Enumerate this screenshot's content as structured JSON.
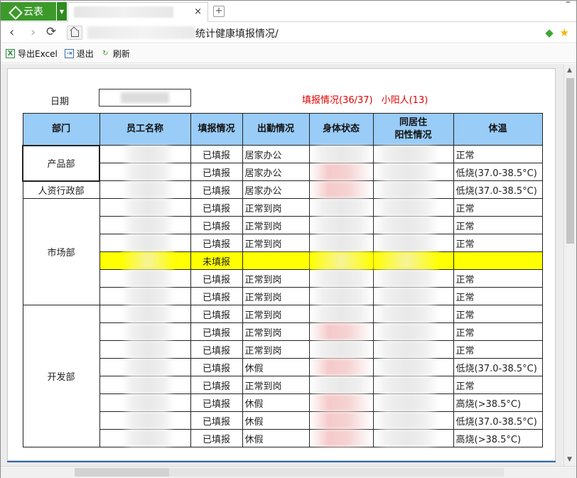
{
  "app": {
    "name": "云表",
    "accent": "#3b9a2a"
  },
  "tab": {
    "close": "×",
    "new_tab": "+"
  },
  "nav": {
    "back": "‹",
    "forward": "›",
    "reload": "⟳"
  },
  "address": {
    "visible_text": "统计健康填报情况/"
  },
  "window_controls": {
    "minimize": "–",
    "close": "✕"
  },
  "toolbar": {
    "export_label": "导出Excel",
    "exit_label": "退出",
    "refresh_label": "刷新"
  },
  "form": {
    "date_label": "日期"
  },
  "summary": {
    "report_status": "填报情况(36/37)",
    "positive": "小阳人(13)"
  },
  "table": {
    "headers": [
      "部门",
      "员工名称",
      "填报情况",
      "出勤情况",
      "身体状态",
      "同居住\n阳性情况",
      "体温"
    ],
    "rows": [
      {
        "dept": "产品部",
        "report": "已填报",
        "attendance": "居家办公",
        "temp": "正常"
      },
      {
        "dept": "",
        "report": "已填报",
        "attendance": "居家办公",
        "temp": "低烧(37.0-38.5°C)"
      },
      {
        "dept": "人资行政部",
        "report": "已填报",
        "attendance": "居家办公",
        "temp": "低烧(37.0-38.5°C)"
      },
      {
        "dept": "市场部",
        "report": "已填报",
        "attendance": "正常到岗",
        "temp": "正常"
      },
      {
        "dept": "",
        "report": "已填报",
        "attendance": "正常到岗",
        "temp": "正常"
      },
      {
        "dept": "",
        "report": "已填报",
        "attendance": "正常到岗",
        "temp": "正常"
      },
      {
        "dept": "",
        "report": "未填报",
        "attendance": "",
        "temp": ""
      },
      {
        "dept": "",
        "report": "已填报",
        "attendance": "正常到岗",
        "temp": "正常"
      },
      {
        "dept": "",
        "report": "已填报",
        "attendance": "正常到岗",
        "temp": "正常"
      },
      {
        "dept": "开发部",
        "report": "已填报",
        "attendance": "正常到岗",
        "temp": "正常"
      },
      {
        "dept": "",
        "report": "已填报",
        "attendance": "正常到岗",
        "temp": "正常"
      },
      {
        "dept": "",
        "report": "已填报",
        "attendance": "正常到岗",
        "temp": "正常"
      },
      {
        "dept": "",
        "report": "已填报",
        "attendance": "休假",
        "temp": "低烧(37.0-38.5°C)"
      },
      {
        "dept": "",
        "report": "已填报",
        "attendance": "正常到岗",
        "temp": "正常"
      },
      {
        "dept": "",
        "report": "已填报",
        "attendance": "休假",
        "temp": "高烧(>38.5°C)"
      },
      {
        "dept": "",
        "report": "已填报",
        "attendance": "休假",
        "temp": "低烧(37.0-38.5°C)"
      },
      {
        "dept": "",
        "report": "已填报",
        "attendance": "休假",
        "temp": "高烧(>38.5°C)"
      }
    ]
  },
  "colors": {
    "header_bg": "#99ccf7",
    "highlight_row": "#ffff00",
    "summary_text": "#e00000"
  }
}
